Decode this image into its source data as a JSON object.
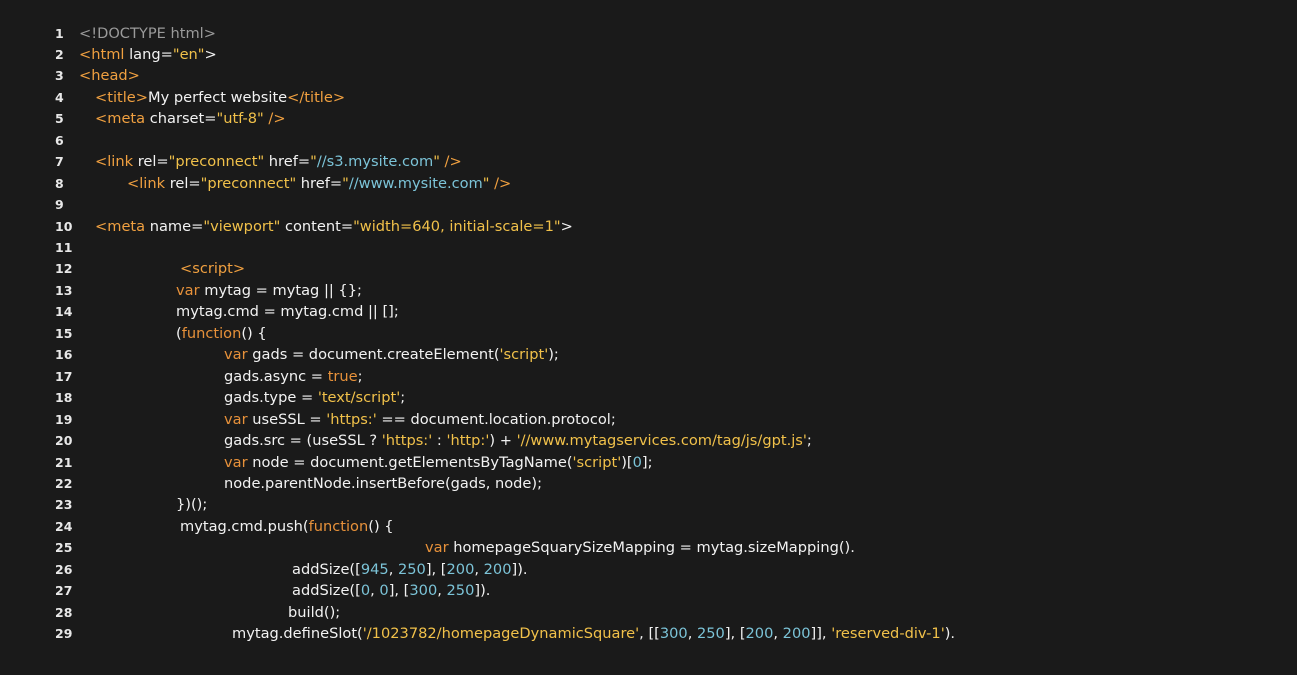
{
  "editor": {
    "background": "#1a1a1a",
    "colors": {
      "tag": "#f0a040",
      "attribute": "#f2f2f2",
      "string": "#f1c14a",
      "url": "#7cc4d8",
      "keyword": "#e7913a",
      "number": "#7cc4d8",
      "doctype": "#9a9a9a"
    },
    "lines": [
      {
        "number": "1",
        "tokens": [
          {
            "t": "<!DOCTYPE html>",
            "c": "doc"
          }
        ]
      },
      {
        "number": "2",
        "tokens": [
          {
            "t": "<html ",
            "c": "tag"
          },
          {
            "t": "lang=",
            "c": "attr"
          },
          {
            "t": "\"en\"",
            "c": "str"
          },
          {
            "t": ">",
            "c": "attr"
          }
        ]
      },
      {
        "number": "3",
        "tokens": [
          {
            "t": "<head>",
            "c": "tag"
          }
        ]
      },
      {
        "number": "4",
        "tokens": [
          {
            "t": "<title>",
            "c": "tag"
          },
          {
            "t": "My perfect website",
            "c": "text"
          },
          {
            "t": "</title>",
            "c": "tag"
          }
        ]
      },
      {
        "number": "5",
        "tokens": [
          {
            "t": "<meta ",
            "c": "tag"
          },
          {
            "t": "charset=",
            "c": "attr"
          },
          {
            "t": "\"utf-8\"",
            "c": "str"
          },
          {
            "t": " />",
            "c": "tag"
          }
        ]
      },
      {
        "number": "6",
        "tokens": []
      },
      {
        "number": "7",
        "tokens": [
          {
            "t": "<link ",
            "c": "tag"
          },
          {
            "t": "rel=",
            "c": "attr"
          },
          {
            "t": "\"preconnect\"",
            "c": "str"
          },
          {
            "t": " href=",
            "c": "attr"
          },
          {
            "t": "\"",
            "c": "str"
          },
          {
            "t": "//s3.mysite.com",
            "c": "url"
          },
          {
            "t": "\"",
            "c": "str"
          },
          {
            "t": " />",
            "c": "tag"
          }
        ]
      },
      {
        "number": "8",
        "tokens": [
          {
            "t": "<link ",
            "c": "tag"
          },
          {
            "t": "rel=",
            "c": "attr"
          },
          {
            "t": "\"preconnect\"",
            "c": "str"
          },
          {
            "t": " href=",
            "c": "attr"
          },
          {
            "t": "\"",
            "c": "str"
          },
          {
            "t": "//www.mysite.com",
            "c": "url"
          },
          {
            "t": "\"",
            "c": "str"
          },
          {
            "t": " />",
            "c": "tag"
          }
        ]
      },
      {
        "number": "9",
        "tokens": []
      },
      {
        "number": "10",
        "tokens": [
          {
            "t": "<meta ",
            "c": "tag"
          },
          {
            "t": "name=",
            "c": "attr"
          },
          {
            "t": "\"viewport\"",
            "c": "str"
          },
          {
            "t": " content=",
            "c": "attr"
          },
          {
            "t": "\"width=640, initial-scale=1\"",
            "c": "str"
          },
          {
            "t": ">",
            "c": "attr"
          }
        ]
      },
      {
        "number": "11",
        "tokens": []
      },
      {
        "number": "12",
        "tokens": [
          {
            "t": "<script>",
            "c": "tag"
          }
        ]
      },
      {
        "number": "13",
        "tokens": [
          {
            "t": "var",
            "c": "kw"
          },
          {
            "t": " mytag = mytag || {};",
            "c": "text"
          }
        ]
      },
      {
        "number": "14",
        "tokens": [
          {
            "t": "mytag.cmd = mytag.cmd || [];",
            "c": "text"
          }
        ]
      },
      {
        "number": "15",
        "tokens": [
          {
            "t": "(",
            "c": "text"
          },
          {
            "t": "function",
            "c": "kw"
          },
          {
            "t": "() {",
            "c": "text"
          }
        ]
      },
      {
        "number": "16",
        "tokens": [
          {
            "t": "var",
            "c": "kw"
          },
          {
            "t": " gads = document.createElement(",
            "c": "text"
          },
          {
            "t": "'script'",
            "c": "sstr"
          },
          {
            "t": ");",
            "c": "text"
          }
        ]
      },
      {
        "number": "17",
        "tokens": [
          {
            "t": "gads.async = ",
            "c": "text"
          },
          {
            "t": "true",
            "c": "kw"
          },
          {
            "t": ";",
            "c": "text"
          }
        ]
      },
      {
        "number": "18",
        "tokens": [
          {
            "t": "gads.type = ",
            "c": "text"
          },
          {
            "t": "'text/script'",
            "c": "sstr"
          },
          {
            "t": ";",
            "c": "text"
          }
        ]
      },
      {
        "number": "19",
        "tokens": [
          {
            "t": "var",
            "c": "kw"
          },
          {
            "t": " useSSL = ",
            "c": "text"
          },
          {
            "t": "'https:'",
            "c": "sstr"
          },
          {
            "t": " == document.location.protocol;",
            "c": "text"
          }
        ]
      },
      {
        "number": "20",
        "tokens": [
          {
            "t": "gads.src = (useSSL ? ",
            "c": "text"
          },
          {
            "t": "'https:'",
            "c": "sstr"
          },
          {
            "t": " : ",
            "c": "text"
          },
          {
            "t": "'http:'",
            "c": "sstr"
          },
          {
            "t": ") + ",
            "c": "text"
          },
          {
            "t": "'//www.mytagservices.com/tag/js/gpt.js'",
            "c": "sstr"
          },
          {
            "t": ";",
            "c": "text"
          }
        ]
      },
      {
        "number": "21",
        "tokens": [
          {
            "t": "var",
            "c": "kw"
          },
          {
            "t": " node = document.getElementsByTagName(",
            "c": "text"
          },
          {
            "t": "'script'",
            "c": "sstr"
          },
          {
            "t": ")[",
            "c": "text"
          },
          {
            "t": "0",
            "c": "num"
          },
          {
            "t": "];",
            "c": "text"
          }
        ]
      },
      {
        "number": "22",
        "tokens": [
          {
            "t": "node.parentNode.insertBefore(gads, node);",
            "c": "text"
          }
        ]
      },
      {
        "number": "23",
        "tokens": [
          {
            "t": "})();",
            "c": "text"
          }
        ]
      },
      {
        "number": "24",
        "tokens": [
          {
            "t": "mytag.cmd.push(",
            "c": "text"
          },
          {
            "t": "function",
            "c": "kw"
          },
          {
            "t": "() {",
            "c": "text"
          }
        ]
      },
      {
        "number": "25",
        "tokens": [
          {
            "t": "var",
            "c": "kw"
          },
          {
            "t": " homepageSquarySizeMapping = mytag.sizeMapping().",
            "c": "text"
          }
        ]
      },
      {
        "number": "26",
        "tokens": [
          {
            "t": "addSize([",
            "c": "text"
          },
          {
            "t": "945",
            "c": "num"
          },
          {
            "t": ", ",
            "c": "text"
          },
          {
            "t": "250",
            "c": "num"
          },
          {
            "t": "], [",
            "c": "text"
          },
          {
            "t": "200",
            "c": "num"
          },
          {
            "t": ", ",
            "c": "text"
          },
          {
            "t": "200",
            "c": "num"
          },
          {
            "t": "]).",
            "c": "text"
          }
        ]
      },
      {
        "number": "27",
        "tokens": [
          {
            "t": "addSize([",
            "c": "text"
          },
          {
            "t": "0",
            "c": "num"
          },
          {
            "t": ", ",
            "c": "text"
          },
          {
            "t": "0",
            "c": "num"
          },
          {
            "t": "], [",
            "c": "text"
          },
          {
            "t": "300",
            "c": "num"
          },
          {
            "t": ", ",
            "c": "text"
          },
          {
            "t": "250",
            "c": "num"
          },
          {
            "t": "]).",
            "c": "text"
          }
        ]
      },
      {
        "number": "28",
        "tokens": [
          {
            "t": "build();",
            "c": "text"
          }
        ]
      },
      {
        "number": "29",
        "tokens": [
          {
            "t": "mytag.defineSlot(",
            "c": "text"
          },
          {
            "t": "'/1023782/homepageDynamicSquare'",
            "c": "sstr"
          },
          {
            "t": ", [[",
            "c": "text"
          },
          {
            "t": "300",
            "c": "num"
          },
          {
            "t": ", ",
            "c": "text"
          },
          {
            "t": "250",
            "c": "num"
          },
          {
            "t": "], [",
            "c": "text"
          },
          {
            "t": "200",
            "c": "num"
          },
          {
            "t": ", ",
            "c": "text"
          },
          {
            "t": "200",
            "c": "num"
          },
          {
            "t": "]], ",
            "c": "text"
          },
          {
            "t": "'reserved-div-1'",
            "c": "sstr"
          },
          {
            "t": ").",
            "c": "text"
          }
        ]
      }
    ]
  }
}
